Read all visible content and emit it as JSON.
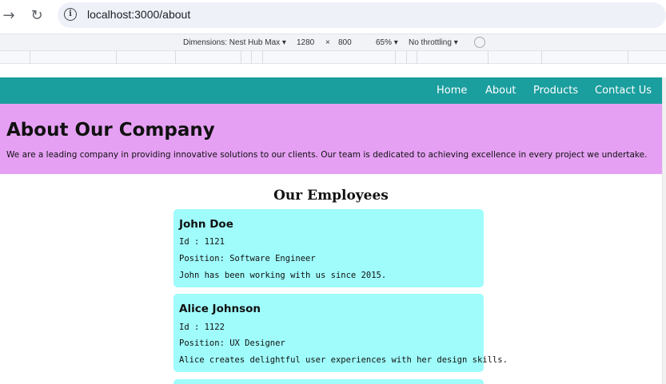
{
  "browser": {
    "url": "localhost:3000/about",
    "back_icon": "arrow-right-icon",
    "reload_icon": "reload-icon"
  },
  "devtools": {
    "dimensions_label": "Dimensions: Nest Hub Max ▾",
    "width": "1280",
    "times": "×",
    "height": "800",
    "zoom": "65% ▾",
    "throttling": "No throttling ▾"
  },
  "site": {
    "nav": [
      "Home",
      "About",
      "Products",
      "Contact Us"
    ],
    "hero_title": "About Our Company",
    "hero_text": "We are a leading company in providing innovative solutions to our clients. Our team is dedicated to achieving excellence in every project we undertake.",
    "employees_title": "Our Employees",
    "employees": [
      {
        "name": "John Doe",
        "id": "Id : 1121",
        "position": "Position: Software Engineer",
        "bio": "John has been working with us since 2015."
      },
      {
        "name": "Alice Johnson",
        "id": "Id : 1122",
        "position": "Position: UX Designer",
        "bio": "Alice creates delightful user experiences with her design skills."
      }
    ]
  },
  "colors": {
    "nav_bg": "#1a9e9e",
    "hero_bg": "#e5a0f3",
    "card_bg": "#9ffcfb"
  }
}
